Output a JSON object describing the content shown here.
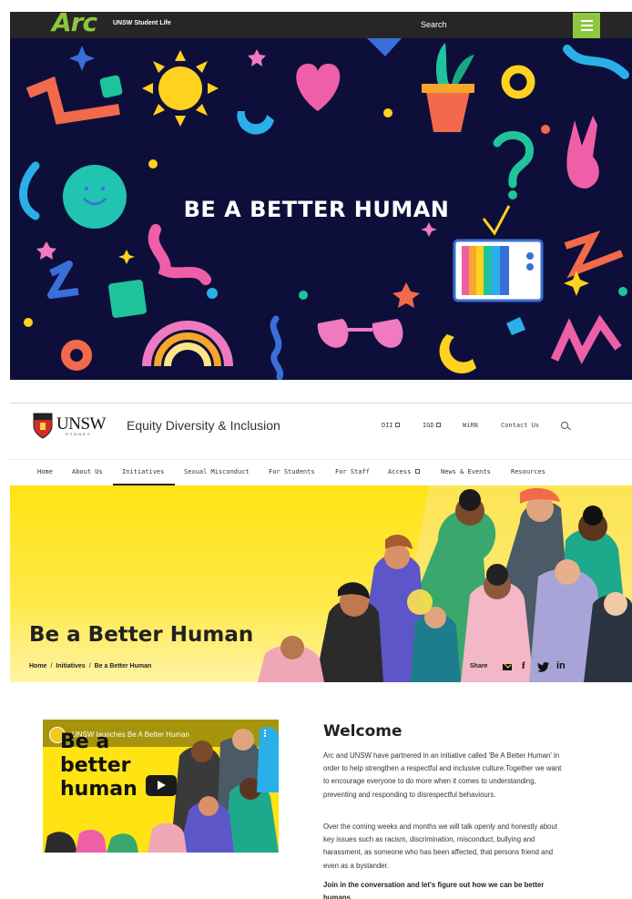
{
  "arc_bar": {
    "logo": "Arc",
    "subtitle": "UNSW Student Life",
    "search_label": "Search"
  },
  "hero": {
    "title": "BE A BETTER HUMAN"
  },
  "unsw_header": {
    "logo_word": "UNSW",
    "logo_sub": "SYDNEY",
    "site_title": "Equity Diversity & Inclusion",
    "utility_links": [
      "DII",
      "IGD",
      "WiRN",
      "Contact Us"
    ]
  },
  "nav": {
    "items": [
      "Home",
      "About Us",
      "Initiatives",
      "Sexual Misconduct",
      "For Students",
      "For Staff",
      "Access",
      "News & Events",
      "Resources"
    ],
    "active": "Initiatives"
  },
  "banner": {
    "title": "Be a Better Human",
    "breadcrumbs": [
      "Home",
      "Initiatives",
      "Be a Better Human"
    ],
    "share_label": "Share",
    "share_icons": [
      "email-icon",
      "facebook-icon",
      "twitter-icon",
      "linkedin-icon"
    ]
  },
  "video": {
    "title": "UNSW launches Be A Better Human",
    "thumbnail_text": "Be a better human"
  },
  "welcome": {
    "heading": "Welcome",
    "paragraphs": [
      "Arc and UNSW have partnered in an initiative called 'Be A Better Human' in order to help strengthen a respectful and inclusive culture.Together we want to encourage everyone to do more when it comes to understanding, preventing and responding to disrespectful behaviours.",
      "Over the coming weeks and months we will talk openly and honestly about key issues such as racism, discrimination, misconduct, bullying and harassment, as someone who has been affected, that persons friend and even as a bystander.",
      "Join in the conversation and let's figure out how we can be better humans."
    ]
  },
  "colors": {
    "arc_green": "#8dc63f",
    "hero_bg": "#0d0f3a",
    "banner_yellow": "#ffe312"
  }
}
